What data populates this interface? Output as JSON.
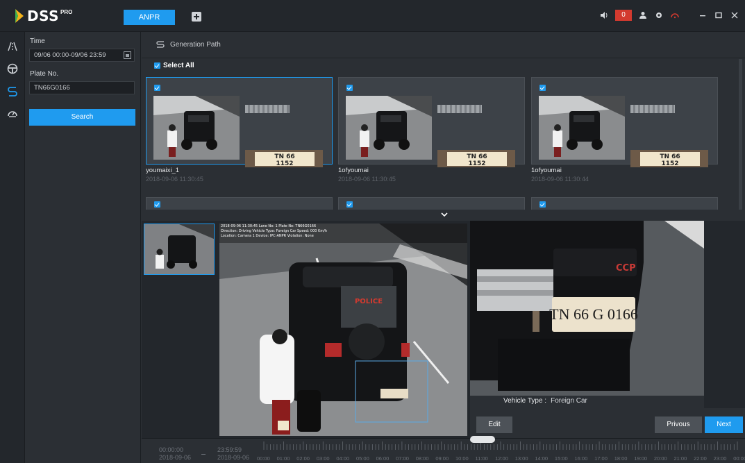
{
  "app": {
    "logo_text": "DSS",
    "logo_sup": "PRO",
    "active_tab": "ANPR",
    "alarm_count": "0",
    "window_controls": [
      "minimize-icon",
      "maximize-icon",
      "close-icon"
    ]
  },
  "rail": {
    "icons": [
      "road-icon",
      "steering-wheel-icon",
      "route-icon",
      "speedometer-icon"
    ],
    "active_index": 2
  },
  "search": {
    "time_label": "Time",
    "time_value": "09/06 00:00-09/06 23:59",
    "plate_label": "Plate No.",
    "plate_value": "TN66G0166",
    "search_button": "Search"
  },
  "main": {
    "generation_path": "Generation Path",
    "select_all": "Select All"
  },
  "results": [
    {
      "name": "youmaixi_1",
      "time": "2018-09-06 11:30:45",
      "plate_text_top": "TN 66",
      "plate_text_bottom": "1152",
      "selected": true
    },
    {
      "name": "1ofyoumai",
      "time": "2018-09-06 11:30:45",
      "plate_text_top": "TN 66",
      "plate_text_bottom": "1152",
      "selected": false
    },
    {
      "name": "1ofyoumai",
      "time": "2018-09-06 11:30:44",
      "plate_text_top": "TN 66",
      "plate_text_bottom": "1152",
      "selected": false
    }
  ],
  "viewer": {
    "overlay_line1": "2018-09-06 11:30:45 Lane No: 1 Plate No: TN66G0166",
    "overlay_line2": "Direction: Driving Vehicle Type: Foreign Car Speed: 000 Km/h",
    "overlay_line3": "Location: Camera 1 Device: IPC-ANPR Violation: None",
    "plate_zoom_text": "TN 66 G 0166",
    "vehicle_type_label": "Vehicle Type :",
    "vehicle_type_value": "Foreign Car",
    "edit_button": "Edit",
    "previous_button": "Privous",
    "next_button": "Next",
    "police_text": "POLICE",
    "ccp_text": "CCP"
  },
  "timeline": {
    "start_time": "00:00:00",
    "start_date": "2018-09-06",
    "end_time": "23:59:59",
    "end_date": "2018-09-06",
    "hours": [
      "00:00",
      "01:00",
      "02:00",
      "03:00",
      "04:00",
      "05:00",
      "06:00",
      "07:00",
      "08:00",
      "09:00",
      "10:00",
      "11:00",
      "12:00",
      "13:00",
      "14:00",
      "15:00",
      "16:00",
      "17:00",
      "18:00",
      "19:00",
      "20:00",
      "21:00",
      "22:00",
      "23:00",
      "00:00"
    ]
  },
  "colors": {
    "accent": "#1f9bef",
    "alarm": "#d33a2f",
    "panel": "#2b2f34",
    "dark": "#23272c"
  }
}
